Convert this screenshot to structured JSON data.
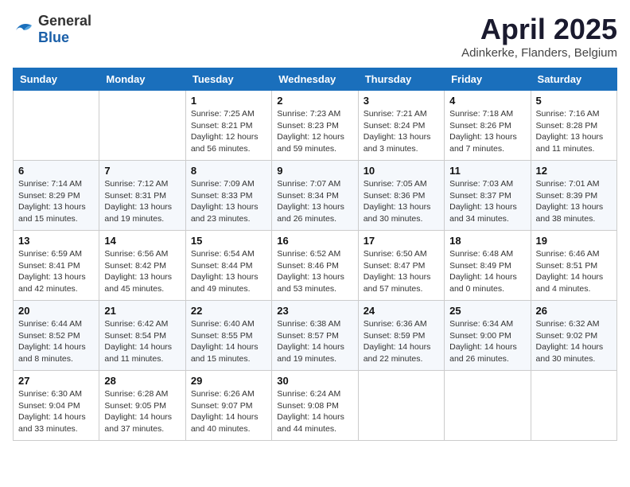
{
  "logo": {
    "general": "General",
    "blue": "Blue"
  },
  "title": {
    "month_year": "April 2025",
    "location": "Adinkerke, Flanders, Belgium"
  },
  "weekdays": [
    "Sunday",
    "Monday",
    "Tuesday",
    "Wednesday",
    "Thursday",
    "Friday",
    "Saturday"
  ],
  "weeks": [
    [
      {
        "day": "",
        "sunrise": "",
        "sunset": "",
        "daylight": ""
      },
      {
        "day": "",
        "sunrise": "",
        "sunset": "",
        "daylight": ""
      },
      {
        "day": "1",
        "sunrise": "Sunrise: 7:25 AM",
        "sunset": "Sunset: 8:21 PM",
        "daylight": "Daylight: 12 hours and 56 minutes."
      },
      {
        "day": "2",
        "sunrise": "Sunrise: 7:23 AM",
        "sunset": "Sunset: 8:23 PM",
        "daylight": "Daylight: 12 hours and 59 minutes."
      },
      {
        "day": "3",
        "sunrise": "Sunrise: 7:21 AM",
        "sunset": "Sunset: 8:24 PM",
        "daylight": "Daylight: 13 hours and 3 minutes."
      },
      {
        "day": "4",
        "sunrise": "Sunrise: 7:18 AM",
        "sunset": "Sunset: 8:26 PM",
        "daylight": "Daylight: 13 hours and 7 minutes."
      },
      {
        "day": "5",
        "sunrise": "Sunrise: 7:16 AM",
        "sunset": "Sunset: 8:28 PM",
        "daylight": "Daylight: 13 hours and 11 minutes."
      }
    ],
    [
      {
        "day": "6",
        "sunrise": "Sunrise: 7:14 AM",
        "sunset": "Sunset: 8:29 PM",
        "daylight": "Daylight: 13 hours and 15 minutes."
      },
      {
        "day": "7",
        "sunrise": "Sunrise: 7:12 AM",
        "sunset": "Sunset: 8:31 PM",
        "daylight": "Daylight: 13 hours and 19 minutes."
      },
      {
        "day": "8",
        "sunrise": "Sunrise: 7:09 AM",
        "sunset": "Sunset: 8:33 PM",
        "daylight": "Daylight: 13 hours and 23 minutes."
      },
      {
        "day": "9",
        "sunrise": "Sunrise: 7:07 AM",
        "sunset": "Sunset: 8:34 PM",
        "daylight": "Daylight: 13 hours and 26 minutes."
      },
      {
        "day": "10",
        "sunrise": "Sunrise: 7:05 AM",
        "sunset": "Sunset: 8:36 PM",
        "daylight": "Daylight: 13 hours and 30 minutes."
      },
      {
        "day": "11",
        "sunrise": "Sunrise: 7:03 AM",
        "sunset": "Sunset: 8:37 PM",
        "daylight": "Daylight: 13 hours and 34 minutes."
      },
      {
        "day": "12",
        "sunrise": "Sunrise: 7:01 AM",
        "sunset": "Sunset: 8:39 PM",
        "daylight": "Daylight: 13 hours and 38 minutes."
      }
    ],
    [
      {
        "day": "13",
        "sunrise": "Sunrise: 6:59 AM",
        "sunset": "Sunset: 8:41 PM",
        "daylight": "Daylight: 13 hours and 42 minutes."
      },
      {
        "day": "14",
        "sunrise": "Sunrise: 6:56 AM",
        "sunset": "Sunset: 8:42 PM",
        "daylight": "Daylight: 13 hours and 45 minutes."
      },
      {
        "day": "15",
        "sunrise": "Sunrise: 6:54 AM",
        "sunset": "Sunset: 8:44 PM",
        "daylight": "Daylight: 13 hours and 49 minutes."
      },
      {
        "day": "16",
        "sunrise": "Sunrise: 6:52 AM",
        "sunset": "Sunset: 8:46 PM",
        "daylight": "Daylight: 13 hours and 53 minutes."
      },
      {
        "day": "17",
        "sunrise": "Sunrise: 6:50 AM",
        "sunset": "Sunset: 8:47 PM",
        "daylight": "Daylight: 13 hours and 57 minutes."
      },
      {
        "day": "18",
        "sunrise": "Sunrise: 6:48 AM",
        "sunset": "Sunset: 8:49 PM",
        "daylight": "Daylight: 14 hours and 0 minutes."
      },
      {
        "day": "19",
        "sunrise": "Sunrise: 6:46 AM",
        "sunset": "Sunset: 8:51 PM",
        "daylight": "Daylight: 14 hours and 4 minutes."
      }
    ],
    [
      {
        "day": "20",
        "sunrise": "Sunrise: 6:44 AM",
        "sunset": "Sunset: 8:52 PM",
        "daylight": "Daylight: 14 hours and 8 minutes."
      },
      {
        "day": "21",
        "sunrise": "Sunrise: 6:42 AM",
        "sunset": "Sunset: 8:54 PM",
        "daylight": "Daylight: 14 hours and 11 minutes."
      },
      {
        "day": "22",
        "sunrise": "Sunrise: 6:40 AM",
        "sunset": "Sunset: 8:55 PM",
        "daylight": "Daylight: 14 hours and 15 minutes."
      },
      {
        "day": "23",
        "sunrise": "Sunrise: 6:38 AM",
        "sunset": "Sunset: 8:57 PM",
        "daylight": "Daylight: 14 hours and 19 minutes."
      },
      {
        "day": "24",
        "sunrise": "Sunrise: 6:36 AM",
        "sunset": "Sunset: 8:59 PM",
        "daylight": "Daylight: 14 hours and 22 minutes."
      },
      {
        "day": "25",
        "sunrise": "Sunrise: 6:34 AM",
        "sunset": "Sunset: 9:00 PM",
        "daylight": "Daylight: 14 hours and 26 minutes."
      },
      {
        "day": "26",
        "sunrise": "Sunrise: 6:32 AM",
        "sunset": "Sunset: 9:02 PM",
        "daylight": "Daylight: 14 hours and 30 minutes."
      }
    ],
    [
      {
        "day": "27",
        "sunrise": "Sunrise: 6:30 AM",
        "sunset": "Sunset: 9:04 PM",
        "daylight": "Daylight: 14 hours and 33 minutes."
      },
      {
        "day": "28",
        "sunrise": "Sunrise: 6:28 AM",
        "sunset": "Sunset: 9:05 PM",
        "daylight": "Daylight: 14 hours and 37 minutes."
      },
      {
        "day": "29",
        "sunrise": "Sunrise: 6:26 AM",
        "sunset": "Sunset: 9:07 PM",
        "daylight": "Daylight: 14 hours and 40 minutes."
      },
      {
        "day": "30",
        "sunrise": "Sunrise: 6:24 AM",
        "sunset": "Sunset: 9:08 PM",
        "daylight": "Daylight: 14 hours and 44 minutes."
      },
      {
        "day": "",
        "sunrise": "",
        "sunset": "",
        "daylight": ""
      },
      {
        "day": "",
        "sunrise": "",
        "sunset": "",
        "daylight": ""
      },
      {
        "day": "",
        "sunrise": "",
        "sunset": "",
        "daylight": ""
      }
    ]
  ]
}
